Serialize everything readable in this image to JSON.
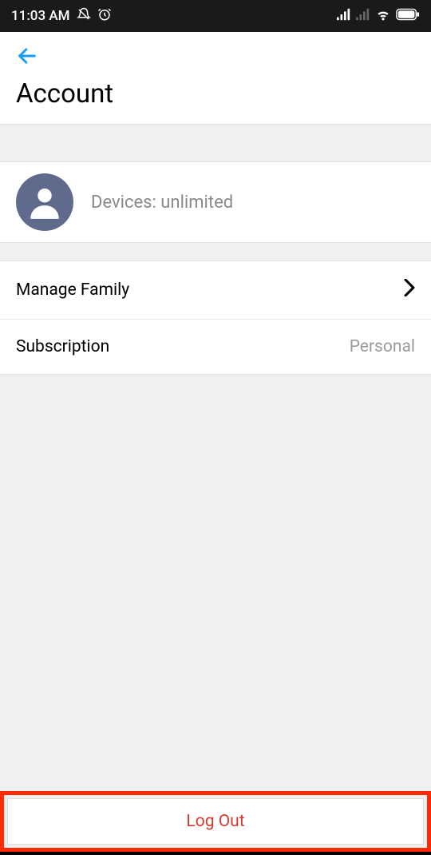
{
  "status": {
    "time": "11:03 AM"
  },
  "header": {
    "title": "Account"
  },
  "profile": {
    "devices_label": "Devices: unlimited"
  },
  "menu": {
    "manage_family": "Manage Family",
    "subscription_label": "Subscription",
    "subscription_value": "Personal"
  },
  "actions": {
    "logout": "Log Out"
  }
}
